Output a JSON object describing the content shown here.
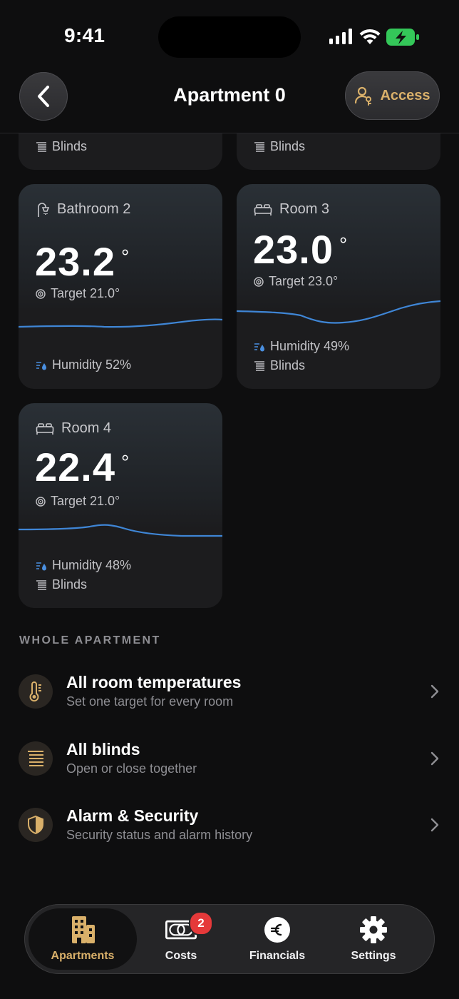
{
  "status": {
    "time": "9:41"
  },
  "nav": {
    "title": "Apartment 0",
    "access_label": "Access"
  },
  "partial_cards": [
    {
      "meta": "Blinds"
    },
    {
      "meta": "Blinds"
    }
  ],
  "rooms": [
    {
      "name": "Bathroom 2",
      "icon": "shower-icon",
      "temp": "23.2",
      "deg": "°",
      "target": "Target 21.0°",
      "humidity": "Humidity 52%",
      "blinds": ""
    },
    {
      "name": "Room 3",
      "icon": "bed-icon",
      "temp": "23.0",
      "deg": "°",
      "target": "Target 23.0°",
      "humidity": "Humidity 49%",
      "blinds": "Blinds"
    },
    {
      "name": "Room 4",
      "icon": "bed-icon",
      "temp": "22.4",
      "deg": "°",
      "target": "Target 21.0°",
      "humidity": "Humidity 48%",
      "blinds": "Blinds"
    }
  ],
  "section": {
    "title": "WHOLE APARTMENT"
  },
  "rows": [
    {
      "title": "All room temperatures",
      "subtitle": "Set one target for every room",
      "icon": "thermometer-icon"
    },
    {
      "title": "All blinds",
      "subtitle": "Open or close together",
      "icon": "blinds-icon"
    },
    {
      "title": "Alarm & Security",
      "subtitle": "Security status and alarm history",
      "icon": "shield-icon"
    }
  ],
  "tabs": [
    {
      "label": "Apartments",
      "icon": "building-icon",
      "active": true
    },
    {
      "label": "Costs",
      "icon": "banknote-icon",
      "badge": "2"
    },
    {
      "label": "Financials",
      "icon": "euro-icon"
    },
    {
      "label": "Settings",
      "icon": "gear-icon"
    }
  ],
  "colors": {
    "accent": "#d9b06a",
    "chart_line": "#3f86d6",
    "badge": "#e5393a",
    "battery": "#34c759"
  }
}
